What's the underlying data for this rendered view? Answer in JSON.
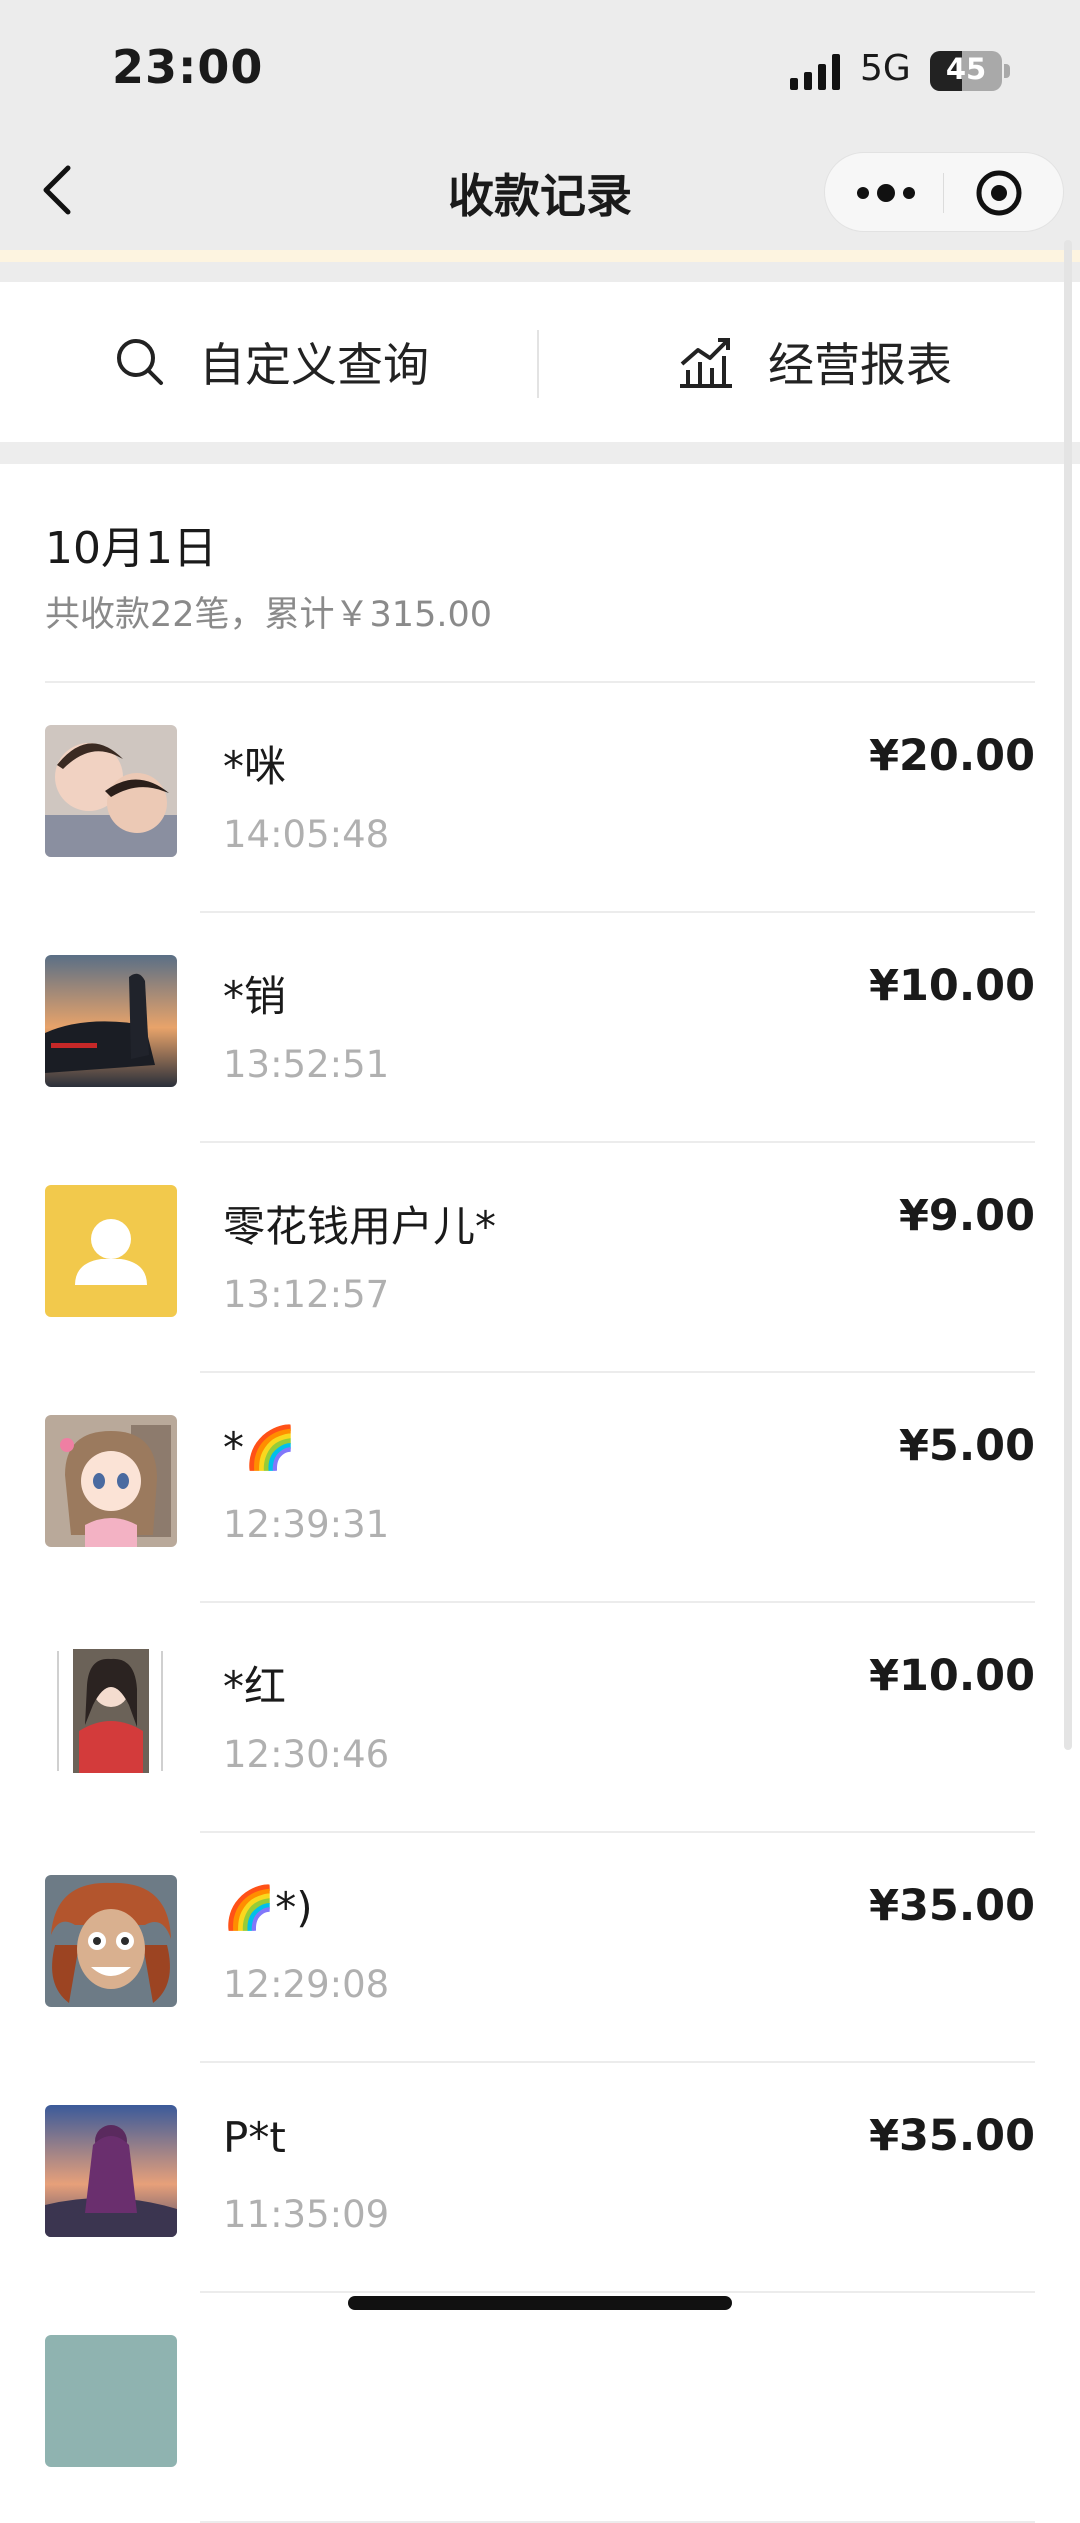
{
  "status_bar": {
    "time": "23:00",
    "network": "5G",
    "battery": "45"
  },
  "nav": {
    "title": "收款记录"
  },
  "actions": [
    {
      "label": "自定义查询",
      "icon": "search-icon"
    },
    {
      "label": "经营报表",
      "icon": "chart-icon"
    }
  ],
  "date_group": {
    "date": "10月1日",
    "summary": "共收款22笔，累计￥315.00"
  },
  "payments": [
    {
      "name": "*咪",
      "time": "14:05:48",
      "amount": "¥20.00",
      "avatar": "photo-children"
    },
    {
      "name": "*销",
      "time": "13:52:51",
      "amount": "¥10.00",
      "avatar": "photo-car-sunset"
    },
    {
      "name": "零花钱用户儿*",
      "time": "13:12:57",
      "amount": "¥9.00",
      "avatar": "default-user-icon"
    },
    {
      "name": "*🌈",
      "time": "12:39:31",
      "amount": "¥5.00",
      "avatar": "anime-girl"
    },
    {
      "name": "*红",
      "time": "12:30:46",
      "amount": "¥10.00",
      "avatar": "photo-woman-red-shirt"
    },
    {
      "name": "🌈*)",
      "time": "12:29:08",
      "amount": "¥35.00",
      "avatar": "cartoon-wild-hair"
    },
    {
      "name": "P*t",
      "time": "11:35:09",
      "amount": "¥35.00",
      "avatar": "photo-girl-sky"
    }
  ],
  "colors": {
    "default_avatar": "#f2c94c",
    "accent_text": "#1a1a1a",
    "muted_text": "#b0b0b0"
  }
}
